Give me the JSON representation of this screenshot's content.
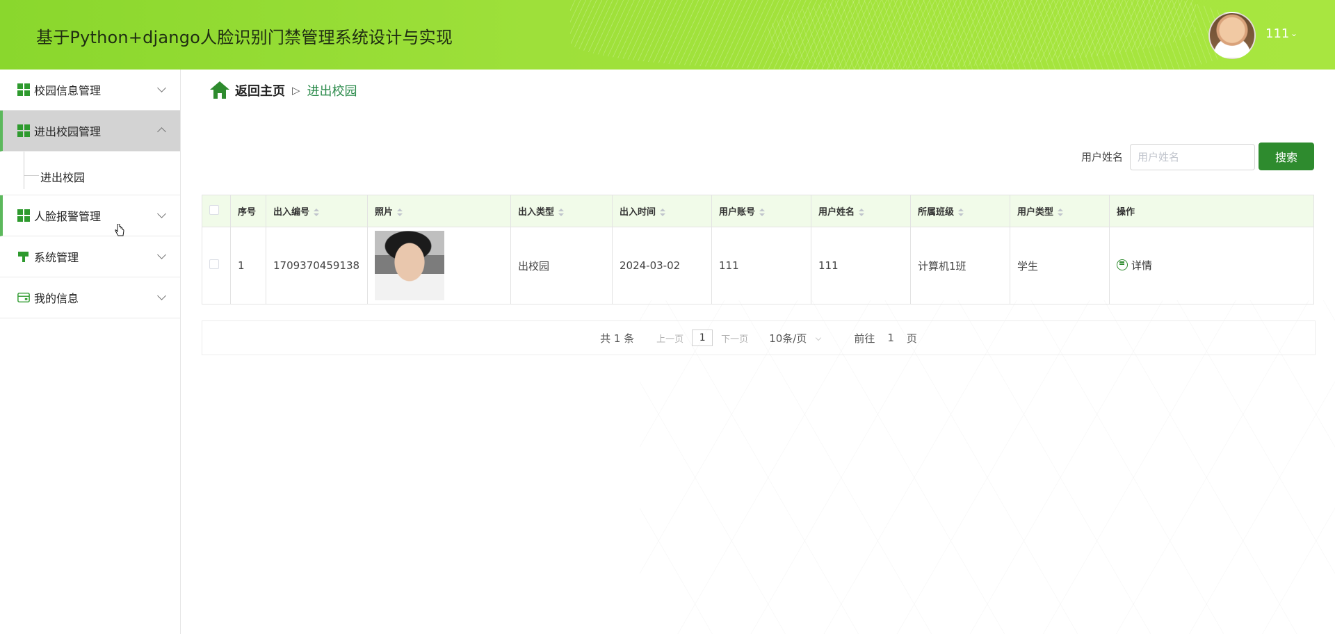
{
  "header": {
    "title": "基于Python+django人脸识别门禁管理系统设计与实现",
    "username": "111"
  },
  "sidebar": {
    "items": [
      {
        "label": "校园信息管理"
      },
      {
        "label": "进出校园管理"
      },
      {
        "label": "人脸报警管理"
      },
      {
        "label": "系统管理"
      },
      {
        "label": "我的信息"
      }
    ],
    "submenu_label": "进出校园"
  },
  "breadcrumb": {
    "home": "返回主页",
    "separator": "▷",
    "current": "进出校园"
  },
  "search": {
    "label": "用户姓名",
    "placeholder": "用户姓名",
    "value": "",
    "button": "搜索"
  },
  "table": {
    "headers": [
      "序号",
      "出入编号",
      "照片",
      "出入类型",
      "出入时间",
      "用户账号",
      "用户姓名",
      "所属班级",
      "用户类型",
      "操作"
    ],
    "rows": [
      {
        "index": "1",
        "code": "1709370459138",
        "type": "出校园",
        "time": "2024-03-02",
        "account": "111",
        "name": "111",
        "class": "计算机1班",
        "user_type": "学生",
        "action": "详情"
      }
    ]
  },
  "pagination": {
    "total": "共 1 条",
    "prev": "上一页",
    "page": "1",
    "next": "下一页",
    "page_size": "10条/页",
    "goto_prefix": "前往",
    "goto_value": "1",
    "goto_suffix": "页"
  },
  "colors": {
    "header_green": "#9ee03a",
    "primary_green": "#2e8b2e",
    "table_header_bg": "#f1fbe9",
    "active_menu_bg": "#d3d3d3"
  }
}
